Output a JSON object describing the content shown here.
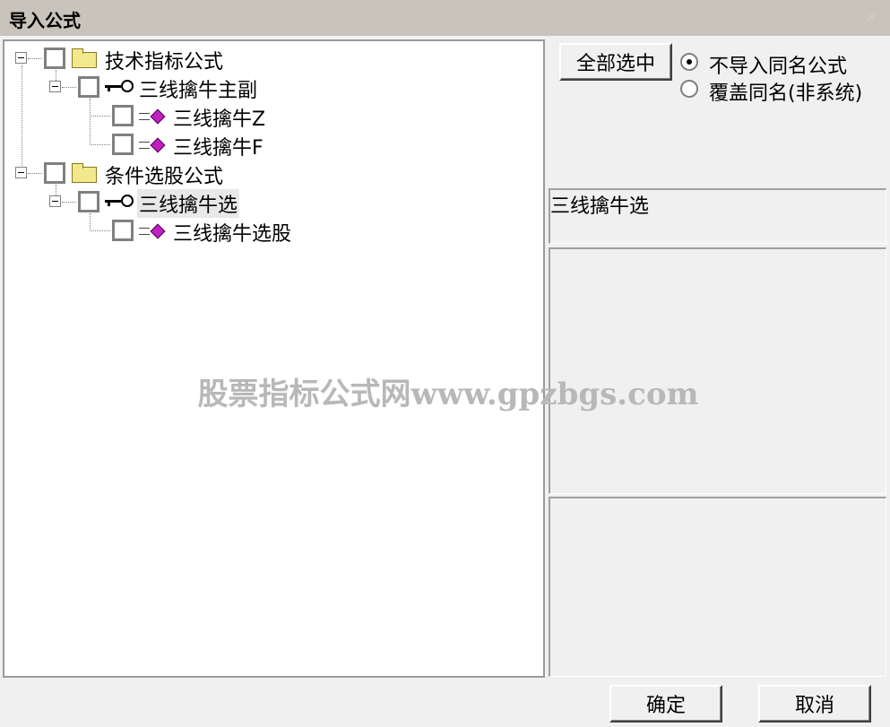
{
  "window": {
    "title": "导入公式",
    "close_glyph": "×"
  },
  "tree": {
    "groups": [
      {
        "label": "技术指标公式",
        "children": [
          {
            "label": "三线擒牛主副",
            "items": [
              "三线擒牛Z",
              "三线擒牛F"
            ]
          }
        ]
      },
      {
        "label": "条件选股公式",
        "children": [
          {
            "label": "三线擒牛选",
            "items": [
              "三线擒牛选股"
            ]
          }
        ]
      }
    ]
  },
  "actions": {
    "select_all_label": "全部选中",
    "ok_label": "确定",
    "cancel_label": "取消"
  },
  "options": {
    "radio_no_import": "不导入同名公式",
    "radio_overwrite": "覆盖同名(非系统)",
    "selected": "no_import"
  },
  "details": {
    "name": "三线擒牛选",
    "description": "",
    "formula": ""
  },
  "watermark": "股票指标公式网www.gpzbgs.com",
  "icons": {
    "group": "folder-icon",
    "formula_set": "key-icon",
    "formula": "formula-icon"
  },
  "colors": {
    "titlebar": "#c8c3bb",
    "formula_icon": "#c020c0",
    "folder_icon": "#f3e88c"
  }
}
